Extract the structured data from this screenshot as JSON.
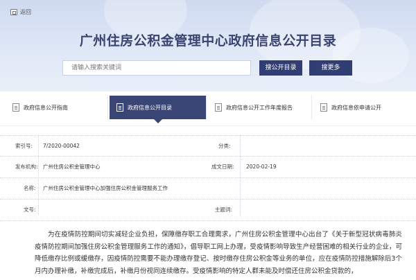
{
  "header": {
    "back_label": "返回",
    "title": "广州住房公积金管理中心政府信息公开目录",
    "search": {
      "placeholder": "请输入搜索关键词"
    },
    "search_button": "搜公开目录",
    "more_button": "搜更多"
  },
  "tabs": [
    {
      "label": "政府信息公开指南",
      "active": false
    },
    {
      "label": "政府信息公开目录",
      "active": true
    },
    {
      "label": "政府信息公开工作年度报告",
      "active": false
    },
    {
      "label": "政府信息依申请公开",
      "active": false
    }
  ],
  "meta": {
    "index_label": "索引号:",
    "index_value": "7/2020-00042",
    "category_label": "分类:",
    "category_value": "",
    "publisher_label": "发布机构:",
    "publisher_value": "广州住房公积金管理中心",
    "date_label": "成文日期:",
    "date_value": "2020-02-19",
    "name_label": "名称:",
    "name_value": "广州住房公积金管理中心加强住房公积金管理服务工作",
    "docno_label": "文号:",
    "docno_value": "",
    "subject_label": "主题词:",
    "subject_value": ""
  },
  "content": {
    "paragraph": "为在疫情防控期间切实减轻企业负担，保障缴存职工合理需求，广州住房公积金管理中心出台了《关于新型冠状病毒肺炎疫情防控期间加强住房公积金管理服务工作的通知》，倡导职工网上办理，受疫情影响导致生产经营困难的相关行业的企业，可降低缴存比例或缓缴存，因疫情防控需要不能办理缴存登记、按时缴存住房公积金等业务的单位，应在疫情防控措施解除后3个月内办理补缴，补缴完成后，补缴月份视同连续缴存。受疫情影响的特定人群未能及时偿还住房公积金贷款的，"
  },
  "colors": {
    "accent": "#313e74",
    "banner": "#dde6f6"
  },
  "icons": {
    "back": "home-icon",
    "tab": "document-icon"
  }
}
